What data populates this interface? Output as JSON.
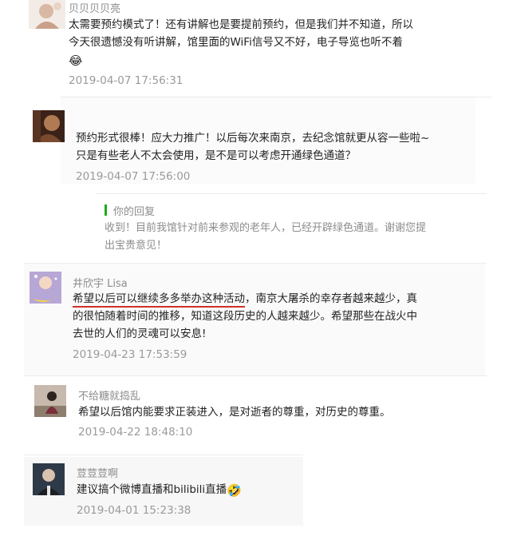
{
  "comments": [
    {
      "user": "贝贝贝贝亮",
      "text": "太需要预约模式了！还有讲解也是要提前预约，但是我们并不知道，所以今天很遗憾没有听讲解，馆里面的WiFi信号又不好，电子导览也听不着",
      "emoji": "😂",
      "time": "2019-04-07 17:56:31"
    },
    {
      "user": "",
      "text": "预约形式很棒！应大力推广！以后每次来南京，去纪念馆就更从容一些啦~只是有些老人不太会使用，是不是可以考虑开通绿色通道？",
      "time": "2019-04-07 17:56:00",
      "reply": {
        "title": "你的回复",
        "text": "收到！目前我馆针对前来参观的老年人，已经开辟绿色通道。谢谢您提出宝贵意见！"
      }
    },
    {
      "user": "井欣宇 Lisa",
      "text_highlight": "希望以后可以继续多多举办这种活动",
      "text_rest": "，南京大屠杀的幸存者越来越少，真的很怕随着时间的推移，知道这段历史的人越来越少。希望那些在战火中去世的人们的灵魂可以安息!",
      "time": "2019-04-23 17:53:59"
    },
    {
      "user": "不给糖就捣乱",
      "text": "希望以后馆内能要求正装进入，是对逝者的尊重，对历史的尊重。",
      "time": "2019-04-22 18:48:10"
    },
    {
      "user": "荳荳荳啊",
      "text": "建议搞个微博直播和bilibili直播",
      "emoji": "🤣",
      "time": "2019-04-01 15:23:38"
    }
  ],
  "colors": {
    "reply_bar": "#1aad19",
    "underline": "#d0312d"
  }
}
